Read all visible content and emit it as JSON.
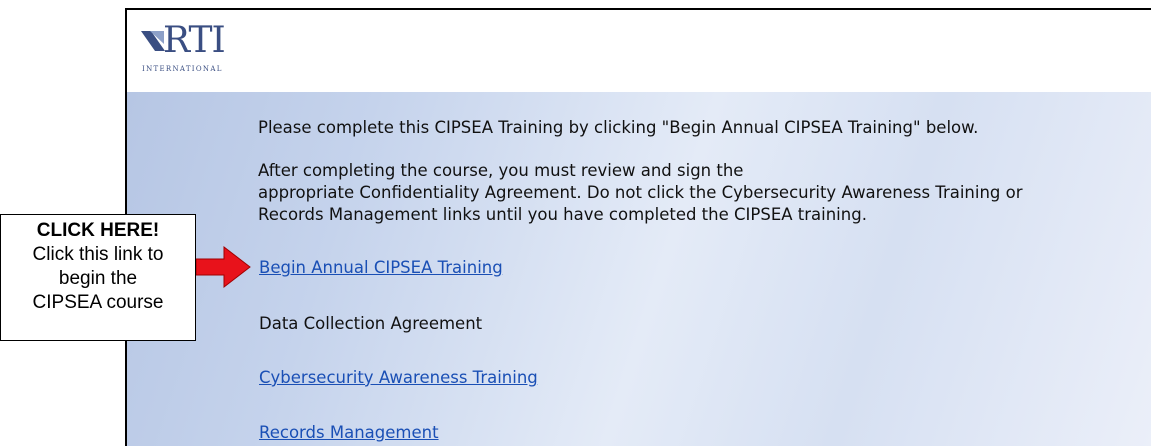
{
  "logo": {
    "name": "RTI",
    "sub": "INTERNATIONAL"
  },
  "instructions": {
    "line1": "Please complete this CIPSEA Training by clicking \"Begin Annual CIPSEA Training\" below.",
    "line2": "After completing the course, you must review and sign the",
    "line3": "appropriate Confidentiality Agreement. Do not click the Cybersecurity Awareness Training or",
    "line4": "Records Management links until you have completed the CIPSEA training."
  },
  "links": {
    "begin": "Begin Annual CIPSEA Training",
    "agreement": "Data Collection Agreement",
    "cyber": "Cybersecurity Awareness Training",
    "records": "Records Management"
  },
  "callout": {
    "title": "CLICK HERE!",
    "line1": "Click this link to",
    "line2": "begin the",
    "line3": "CIPSEA course"
  },
  "colors": {
    "link": "#1a4fb5",
    "arrow": "#e8121b",
    "brand": "#3a4e82"
  }
}
